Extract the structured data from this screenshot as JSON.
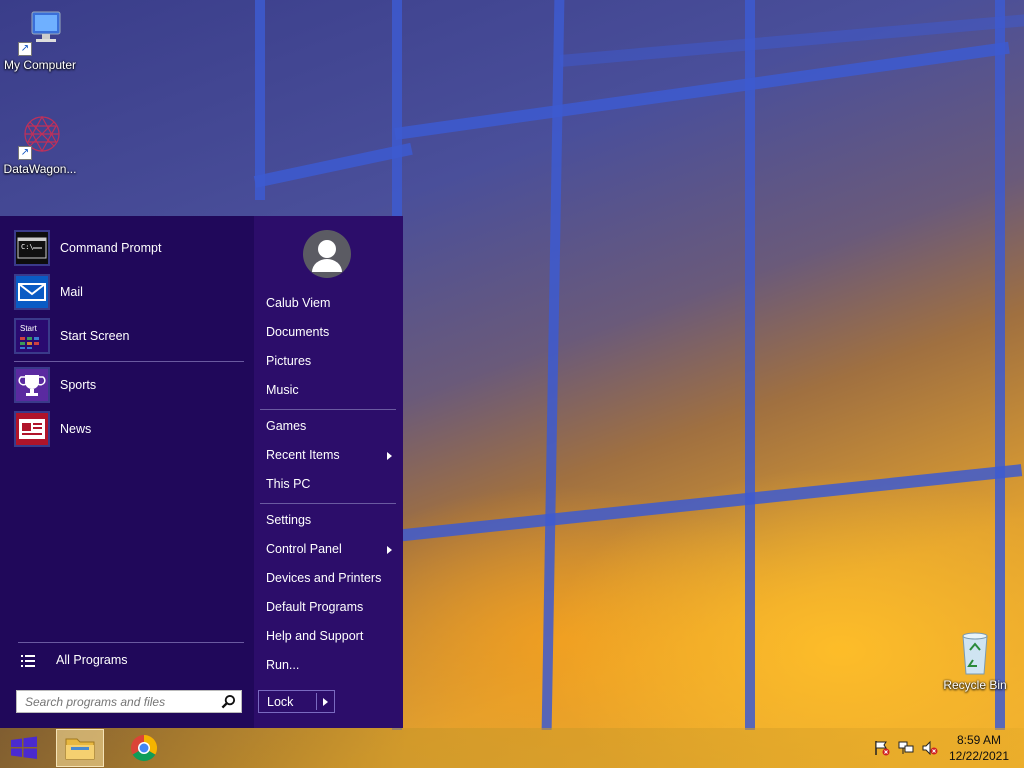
{
  "desktop": {
    "icons": [
      {
        "label": "My Computer",
        "icon": "computer-icon"
      },
      {
        "label": "DataWagon...",
        "icon": "datawagon-icon"
      },
      {
        "label": "Recycle Bin",
        "icon": "recycle-bin-icon"
      }
    ]
  },
  "start_menu": {
    "pinned": [
      {
        "label": "Command Prompt",
        "icon": "command-prompt-icon",
        "color": "#1a1a1a"
      },
      {
        "label": "Mail",
        "icon": "mail-icon",
        "color": "#0a5bc4"
      },
      {
        "label": "Start Screen",
        "icon": "start-screen-icon",
        "tile_text": "Start"
      },
      {
        "label": "Sports",
        "icon": "trophy-icon",
        "color": "#5a2aa0"
      },
      {
        "label": "News",
        "icon": "news-icon",
        "color": "#b0142a"
      }
    ],
    "all_programs": "All Programs",
    "search_placeholder": "Search programs and files",
    "user_name": "Calub Viem",
    "right_items": [
      {
        "label": "Documents"
      },
      {
        "label": "Pictures"
      },
      {
        "label": "Music"
      },
      {
        "label": "Games"
      },
      {
        "label": "Recent Items",
        "submenu": true
      },
      {
        "label": "This PC"
      },
      {
        "label": "Settings"
      },
      {
        "label": "Control Panel",
        "submenu": true
      },
      {
        "label": "Devices and Printers"
      },
      {
        "label": "Default Programs"
      },
      {
        "label": "Help and Support"
      },
      {
        "label": "Run..."
      }
    ],
    "lock_label": "Lock"
  },
  "taskbar": {
    "apps": [
      {
        "name": "file-explorer",
        "icon": "folder-icon",
        "active": true
      },
      {
        "name": "chrome",
        "icon": "chrome-icon",
        "active": false
      }
    ],
    "tray_icons": [
      "action-center-flag-icon",
      "network-icon",
      "volume-muted-icon"
    ],
    "time": "8:59 AM",
    "date": "12/22/2021"
  },
  "colors": {
    "menu_bg": "#20085a",
    "menu_right_bg": "#2c0d6a",
    "accent": "#3d5ad0"
  }
}
